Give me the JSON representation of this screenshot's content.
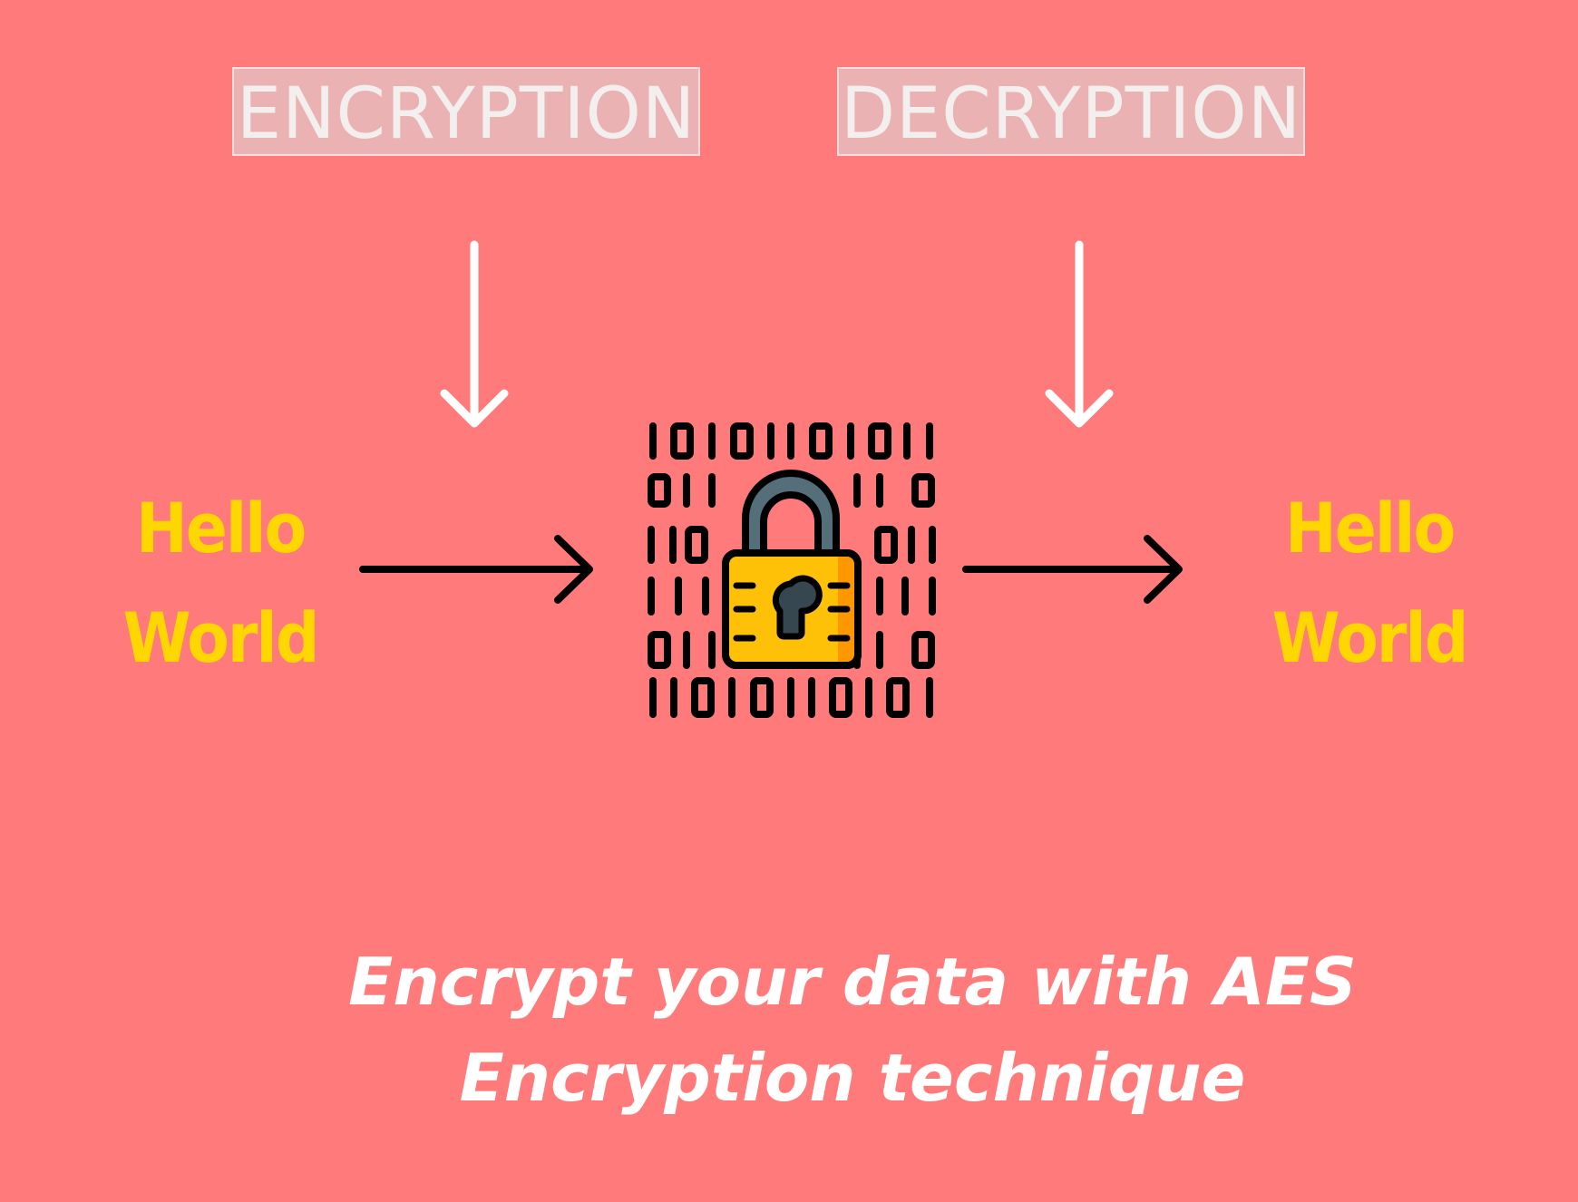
{
  "labels": {
    "encryption": "ENCRYPTION",
    "decryption": "DECRYPTION"
  },
  "input_text": [
    "Hello",
    "World"
  ],
  "output_text": [
    "Hello",
    "World"
  ],
  "caption": {
    "line1": "Encrypt your data with AES",
    "line2": "Encryption technique"
  },
  "icons": {
    "center": "binary-padlock-icon",
    "arrows": "arrow-icon"
  },
  "colors": {
    "background": "#ff7b7b",
    "plaintext": "#ffd700",
    "lock_body": "#ffc107",
    "lock_shackle": "#546e7a",
    "outline": "#000000"
  }
}
